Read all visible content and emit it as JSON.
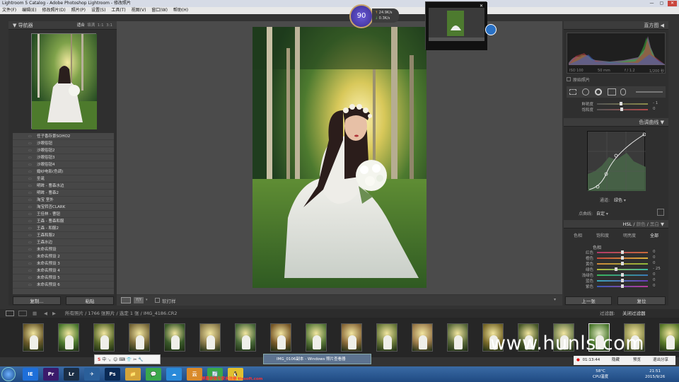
{
  "window": {
    "title": "Lightroom 5 Catalog - Adobe Photoshop Lightroom - 修改照片",
    "min": "—",
    "max": "▢",
    "close": "✕"
  },
  "menu": [
    "文件(F)",
    "编辑(E)",
    "修改照片(D)",
    "照片(P)",
    "设置(S)",
    "工具(T)",
    "视图(V)",
    "窗口(W)",
    "帮助(H)"
  ],
  "navigator": {
    "title": "导航器",
    "modes": [
      "适合",
      "填满",
      "1:1",
      "3:1"
    ]
  },
  "presets": [
    "任子香存景SOHO2",
    "沙眼俗钮",
    "沙眼俗钮2",
    "沙眼俗钮3",
    "沙眼俗钮4",
    "婚纱电影(色调)",
    "圣诞",
    "明眸 - 曹森水边",
    "明眸 - 曹森2",
    "淘宝 室外",
    "淘宝转否CLARK",
    "王佳林 - 曹钮",
    "王森 - 曹森和服",
    "王森 - 和服2",
    "王森和服2",
    "王森水边",
    "未命名预设",
    "未命名预设 2",
    "未命名预设 3",
    "未命名预设 4",
    "未命名预设 5",
    "未命名预设 6"
  ],
  "left_buttons": {
    "copy": "复制...",
    "paste": "粘贴"
  },
  "toolbar": {
    "softproof": "软打样"
  },
  "gauge": {
    "value": "90",
    "upload": "24.9K/s",
    "download": "0.3K/s"
  },
  "right": {
    "histogram_title": "直方图",
    "exif": {
      "iso": "ISO 100",
      "focal": "50 mm",
      "aperture": "f / 1.2",
      "shutter": "1/200 秒"
    },
    "original_photo": "原始照片",
    "saturation_rows": [
      {
        "label": "鲜艳度",
        "value": "- 1"
      },
      {
        "label": "饱和度",
        "value": "0"
      }
    ],
    "curve_title": "色调曲线",
    "channel_label": "通道:",
    "channel_value": "绿色",
    "point_curve_label": "点曲线:",
    "point_curve_value": "自定",
    "hsl_tabs": [
      "HSL",
      "颜色",
      "黑白"
    ],
    "hsl_subtabs": [
      "色相",
      "饱和度",
      "明亮度",
      "全部"
    ],
    "hsl_section": "色相",
    "hsl_rows": [
      {
        "label": "红色",
        "value": "0",
        "pos": 0.5,
        "grad": "linear-gradient(90deg,#b03a6a,#c96a3a)"
      },
      {
        "label": "橙色",
        "value": "0",
        "pos": 0.5,
        "grad": "linear-gradient(90deg,#c54a3a,#d7b23a)"
      },
      {
        "label": "黄色",
        "value": "0",
        "pos": 0.5,
        "grad": "linear-gradient(90deg,#d08a3a,#8fb83a)"
      },
      {
        "label": "绿色",
        "value": "- 25",
        "pos": 0.37,
        "grad": "linear-gradient(90deg,#b8b83a,#3ab8a0)"
      },
      {
        "label": "浅绿色",
        "value": "0",
        "pos": 0.5,
        "grad": "linear-gradient(90deg,#3ab85a,#3a7ab8)"
      },
      {
        "label": "蓝色",
        "value": "0",
        "pos": 0.5,
        "grad": "linear-gradient(90deg,#3aa8b8,#6a3ab8)"
      },
      {
        "label": "紫色",
        "value": "0",
        "pos": 0.5,
        "grad": "linear-gradient(90deg,#3a5ab8,#b83a9a)"
      }
    ],
    "prev_button": "上一张",
    "reset_button": "复位"
  },
  "filmstrip": {
    "path": "所有照片 / 1766 张照片 / 选定 1 张 / IMG_4186.CR2",
    "filter_label": "过滤器:",
    "filter_value": "关闭过滤器"
  },
  "watermark": "www.hunls.com",
  "taskbar": {
    "tooltip": "IMG_0106副本 - Windows 照片查看器",
    "apps": [
      "IE",
      "Pr",
      "Lr",
      "✈",
      "Ps",
      "📁",
      "💬",
      "☁",
      "云",
      "🔄",
      "🐧"
    ],
    "ime": "中",
    "ad_text": "屏幕录像专家未注册 tlxsoft.com",
    "rec_time": "01:13:44",
    "rec_actions": [
      "隐藏",
      "预览",
      "退出分享"
    ],
    "cpu_temp": "58°C",
    "cpu_label": "CPU温度",
    "time": "21:51",
    "date": "2015/9/26"
  }
}
